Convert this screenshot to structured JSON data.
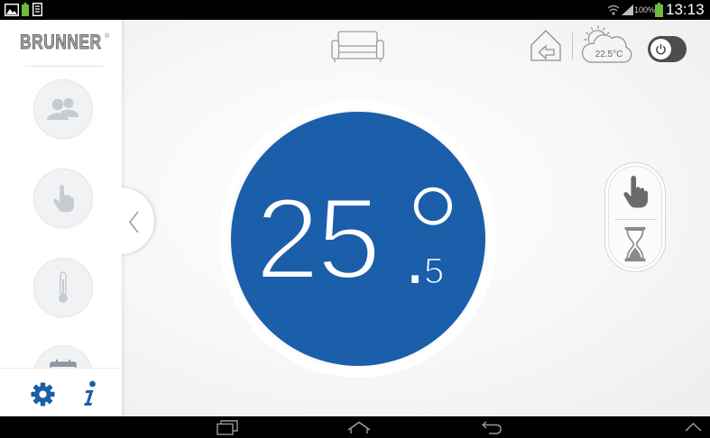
{
  "status_bar": {
    "battery_level": "100%",
    "time": "13:13"
  },
  "sidebar": {
    "logo": "BRUNNER",
    "logo_mark": "®",
    "items": [
      {
        "icon": "users-icon"
      },
      {
        "icon": "hand-icon"
      },
      {
        "icon": "thermometer-icon"
      },
      {
        "icon": "calendar-icon"
      }
    ],
    "footer": [
      {
        "icon": "gear-icon"
      },
      {
        "icon": "info-icon"
      }
    ],
    "collapse_icon": "chevron-left-icon"
  },
  "header": {
    "room_icon": "sofa-icon",
    "home_icon": "house-arrow-icon",
    "weather_icon": "cloud-sun-icon",
    "outdoor_temperature": "22.5°C",
    "power_icon": "power-icon"
  },
  "thermostat": {
    "temperature_whole": "25",
    "decimal_separator": ".",
    "temperature_decimal": "5",
    "degree_symbol": "°"
  },
  "mode_selector": {
    "modes": [
      {
        "icon": "hand-icon"
      },
      {
        "icon": "hourglass-icon"
      }
    ]
  },
  "nav_bar": {
    "buttons": [
      {
        "icon": "recent-apps-icon"
      },
      {
        "icon": "home-icon"
      },
      {
        "icon": "back-icon"
      },
      {
        "icon": "chevron-up-icon"
      }
    ]
  },
  "colors": {
    "accent_blue": "#1b5eaa",
    "sidebar_icon_gray": "#c6cbd2",
    "toggle_dark": "#4d4d4d",
    "status_green": "#6dbb3c"
  }
}
